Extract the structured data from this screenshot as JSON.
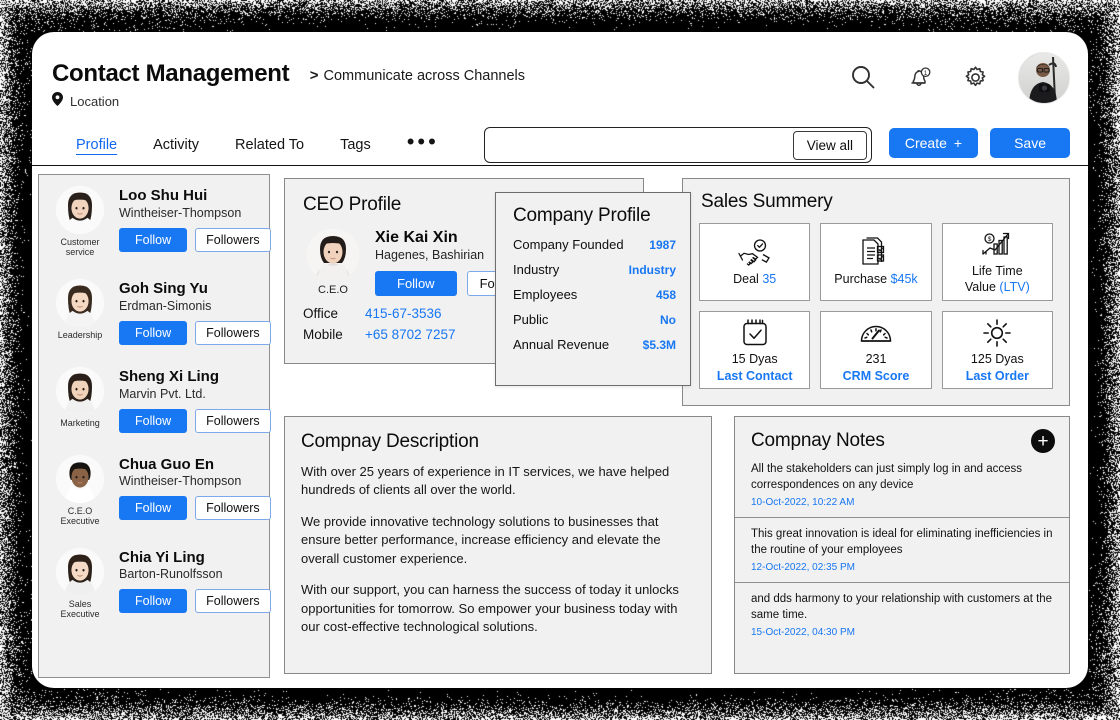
{
  "header": {
    "title": "Contact Management",
    "breadcrumb_sep": ">",
    "breadcrumb": "Communicate across Channels",
    "location": "Location",
    "icons": [
      "search-icon",
      "notification-bell-icon",
      "settings-gear-icon"
    ],
    "notification_count": "1"
  },
  "tabs": [
    {
      "label": "Profile",
      "active": true
    },
    {
      "label": "Activity",
      "active": false
    },
    {
      "label": "Related To",
      "active": false
    },
    {
      "label": "Tags",
      "active": false
    },
    {
      "label": "•••",
      "active": false
    }
  ],
  "toolbar": {
    "view_all": "View all",
    "create": "Create",
    "create_plus": "+",
    "save": "Save"
  },
  "sidebar": {
    "contacts": [
      {
        "name": "Loo Shu Hui",
        "org": "Wintheiser-Thompson",
        "role": "Customer\nservice",
        "follow": "Follow",
        "followers": "Followers"
      },
      {
        "name": "Goh Sing Yu",
        "org": "Erdman-Simonis",
        "role": "Leadership",
        "follow": "Follow",
        "followers": "Followers"
      },
      {
        "name": "Sheng Xi Ling",
        "org": "Marvin Pvt. Ltd.",
        "role": "Marketing",
        "follow": "Follow",
        "followers": "Followers"
      },
      {
        "name": "Chua Guo En",
        "org": "Wintheiser-Thompson",
        "role": "C.E.O\nExecutive",
        "follow": "Follow",
        "followers": "Followers"
      },
      {
        "name": "Chia Yi Ling",
        "org": "Barton-Runolfsson",
        "role": "Sales\nExecutive",
        "follow": "Follow",
        "followers": "Followers"
      }
    ]
  },
  "ceo_profile": {
    "title": "CEO Profile",
    "name": "Xie Kai Xin",
    "company": "Hagenes, Bashirian",
    "role": "C.E.O",
    "follow": "Follow",
    "followers": "Followers",
    "office_label": "Office",
    "office_value": "415-67-3536",
    "mobile_label": "Mobile",
    "mobile_value": "+65 8702 7257"
  },
  "company_profile": {
    "title": "Company Profile",
    "rows": [
      {
        "key": "Company Founded",
        "value": "1987"
      },
      {
        "key": "Industry",
        "value": "Industry"
      },
      {
        "key": "Employees",
        "value": "458"
      },
      {
        "key": "Public",
        "value": "No"
      },
      {
        "key": "Annual Revenue",
        "value": "$5.3M"
      }
    ]
  },
  "sales_summary": {
    "title": "Sales Summery",
    "tiles": [
      {
        "icon": "handshake-deal-icon",
        "line1": "Deal",
        "line1_hl": "35",
        "line2": "",
        "two_line": false
      },
      {
        "icon": "documents-purchase-icon",
        "line1": "Purchase",
        "line1_hl": "$45k",
        "line2": "",
        "two_line": false
      },
      {
        "icon": "growth-chart-icon",
        "line1": "Life Time",
        "line1_hl": "",
        "line2": "Value",
        "line2_hl": "(LTV)",
        "two_line": true
      },
      {
        "icon": "calendar-check-icon",
        "value": "15 Dyas",
        "label": "Last Contact",
        "stacked": true
      },
      {
        "icon": "speedometer-icon",
        "value": "231",
        "label": "CRM Score",
        "stacked": true
      },
      {
        "icon": "sun-icon",
        "value": "125 Dyas",
        "label": "Last Order",
        "stacked": true
      }
    ]
  },
  "company_description": {
    "title": "Compnay Description",
    "paragraphs": [
      "With over 25 years of experience in IT services, we have helped hundreds of clients all over the world.",
      "We provide innovative technology solutions to businesses that ensure better performance, increase efficiency and elevate the overall customer experience.",
      "With our support, you can harness the success of today it unlocks opportunities for tomorrow. So empower your business today with our cost-effective technological solutions."
    ]
  },
  "company_notes": {
    "title": "Compnay Notes",
    "add_label": "+",
    "notes": [
      {
        "text": "All the stakeholders can just simply log in and access correspondences on any device",
        "date": "10-Oct-2022, 10:22 AM"
      },
      {
        "text": "This great innovation is ideal for eliminating inefficiencies in the routine of your employees",
        "date": "12-Oct-2022, 02:35 PM"
      },
      {
        "text": "and dds harmony to your relationship with customers at the same time.",
        "date": "15-Oct-2022, 04:30 PM"
      }
    ]
  },
  "colors": {
    "accent": "#1877f2",
    "card_bg": "#f1f1f1",
    "card_border": "#888888",
    "backdrop": "#000000"
  }
}
